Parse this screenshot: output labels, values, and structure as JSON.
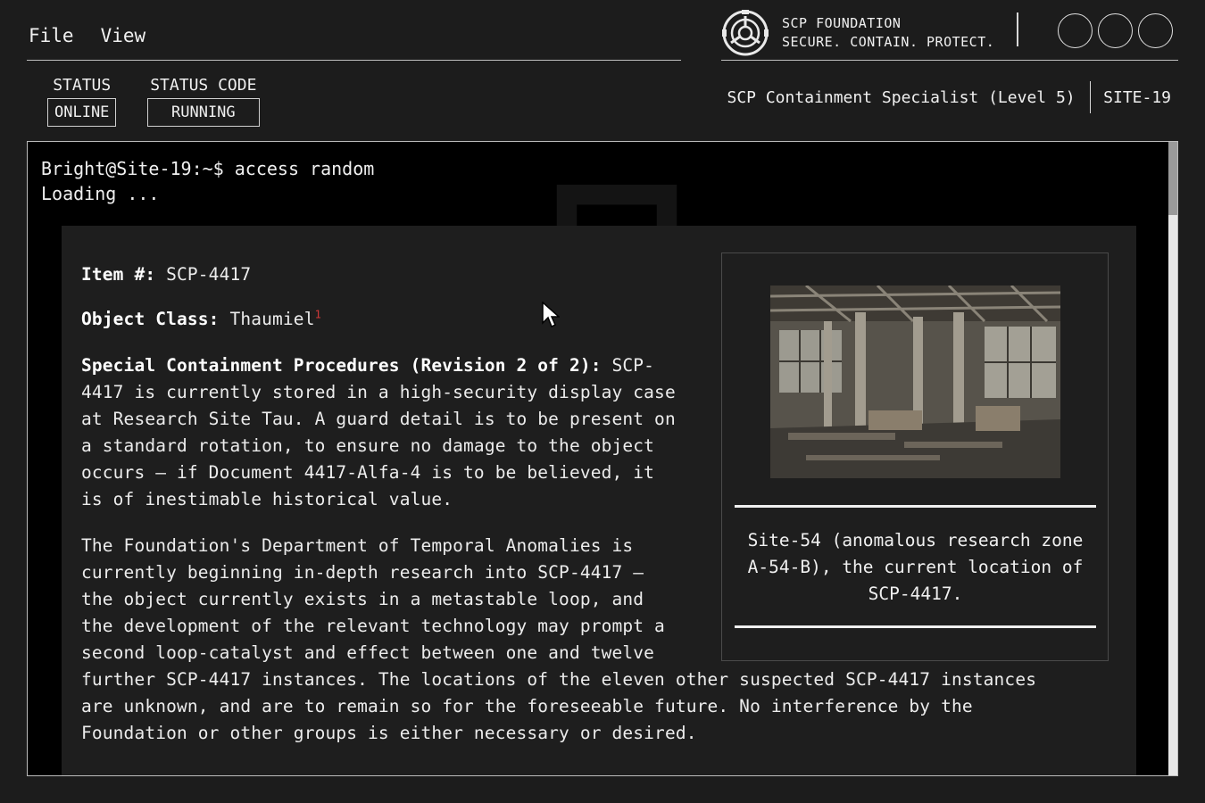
{
  "menu": {
    "items": [
      "File",
      "View"
    ]
  },
  "brand": {
    "name": "SCP FOUNDATION",
    "motto": "SECURE. CONTAIN. PROTECT.",
    "logo_icon": "scp-logo-icon"
  },
  "status": {
    "status_label": "STATUS",
    "status_value": "ONLINE",
    "code_label": "STATUS CODE",
    "code_value": "RUNNING"
  },
  "role": {
    "title": "SCP Containment Specialist (Level 5)",
    "site": "SITE-19"
  },
  "terminal": {
    "prompt": "Bright@Site-19:~$ access random",
    "loading": "Loading ..."
  },
  "document": {
    "item_label": "Item #:",
    "item_value": "SCP-4417",
    "class_label": "Object Class:",
    "class_value": "Thaumiel",
    "class_footnote": "1",
    "scp_label": "Special Containment Procedures (Revision 2 of 2):",
    "scp_text_1": "SCP-",
    "scp_lines": [
      "4417 is currently stored in a high-security display case",
      "at Research Site Tau. A guard detail is to be present on",
      "a standard rotation, to ensure no damage to the object",
      "occurs — if Document 4417-Alfa-4 is to be believed, it",
      "is of inestimable historical value."
    ],
    "para2_lines": [
      "The Foundation's Department of Temporal Anomalies is",
      "currently beginning in-depth research into SCP-4417 —",
      "the object currently exists in a metastable loop, and",
      "the development of the relevant technology may prompt a",
      "second loop-catalyst and effect between one and twelve",
      "further SCP-4417 instances. The locations of the eleven other suspected SCP-4417 instances",
      "are unknown, and are to remain so for the foreseeable future. No interference by the",
      "Foundation or other groups is either necessary or desired."
    ],
    "image_caption": "Site-54 (anomalous research zone A-54-B), the current location of SCP-4417."
  },
  "colors": {
    "background": "#1c1c1c",
    "terminal": "#000000",
    "doc_panel": "#1e1e1e",
    "footnote": "#d23a3a"
  }
}
